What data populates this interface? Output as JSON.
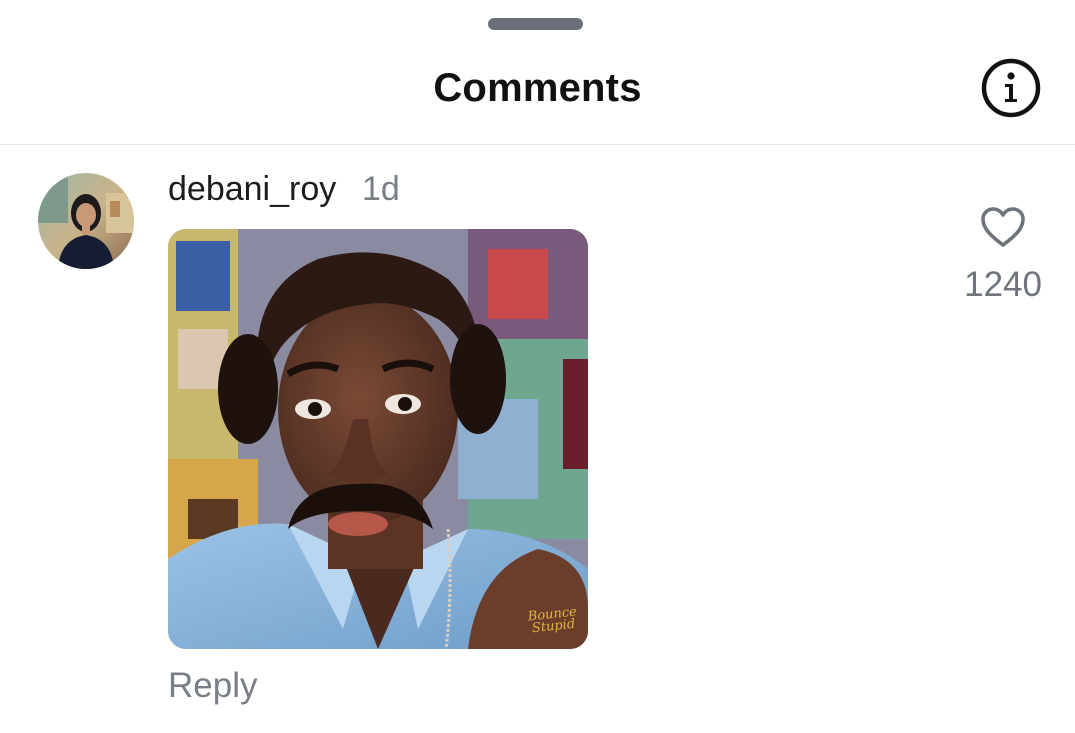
{
  "header": {
    "title": "Comments"
  },
  "icons": {
    "info": "info-circle-icon",
    "like": "heart-outline-icon"
  },
  "comment": {
    "username": "debani_roy",
    "timestamp": "1d",
    "likes": "1240",
    "reply_label": "Reply",
    "media_watermark": "Bounce Stupid"
  },
  "colors": {
    "text_primary": "#111111",
    "text_secondary": "#7a7f87",
    "divider": "#e6e6e6",
    "handle": "#6b7078"
  }
}
